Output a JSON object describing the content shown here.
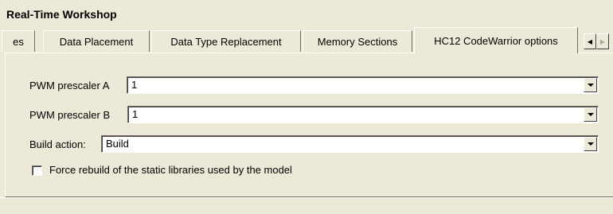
{
  "window": {
    "title": "Real-Time Workshop"
  },
  "tabs": [
    {
      "label": "es"
    },
    {
      "label": "Data Placement"
    },
    {
      "label": "Data Type Replacement"
    },
    {
      "label": "Memory Sections"
    },
    {
      "label": "HC12 CodeWarrior options",
      "active": true
    }
  ],
  "tab_scroll": {
    "left_icon": "arrow-left-icon",
    "right_icon": "arrow-right-icon"
  },
  "form": {
    "pwm_a": {
      "label": "PWM prescaler A",
      "value": "1"
    },
    "pwm_b": {
      "label": "PWM prescaler B",
      "value": "1"
    },
    "build_action": {
      "label": "Build action:",
      "value": "Build"
    },
    "force_rebuild": {
      "label": "Force rebuild of the static libraries used by the model",
      "checked": false
    }
  },
  "colors": {
    "face": "#ece9d8",
    "shadow": "#716f64",
    "highlight": "#ffffff"
  }
}
